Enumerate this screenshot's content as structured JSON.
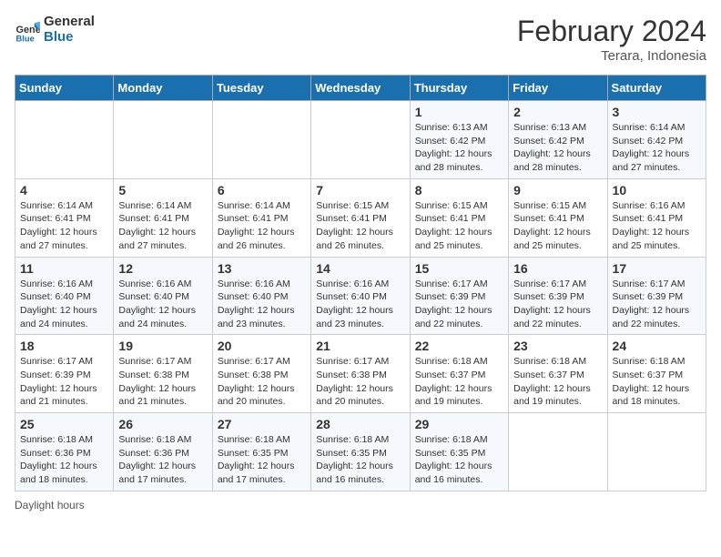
{
  "header": {
    "logo_line1": "General",
    "logo_line2": "Blue",
    "month_year": "February 2024",
    "location": "Terara, Indonesia"
  },
  "days_of_week": [
    "Sunday",
    "Monday",
    "Tuesday",
    "Wednesday",
    "Thursday",
    "Friday",
    "Saturday"
  ],
  "weeks": [
    [
      {
        "day": "",
        "info": ""
      },
      {
        "day": "",
        "info": ""
      },
      {
        "day": "",
        "info": ""
      },
      {
        "day": "",
        "info": ""
      },
      {
        "day": "1",
        "info": "Sunrise: 6:13 AM\nSunset: 6:42 PM\nDaylight: 12 hours and 28 minutes."
      },
      {
        "day": "2",
        "info": "Sunrise: 6:13 AM\nSunset: 6:42 PM\nDaylight: 12 hours and 28 minutes."
      },
      {
        "day": "3",
        "info": "Sunrise: 6:14 AM\nSunset: 6:42 PM\nDaylight: 12 hours and 27 minutes."
      }
    ],
    [
      {
        "day": "4",
        "info": "Sunrise: 6:14 AM\nSunset: 6:41 PM\nDaylight: 12 hours and 27 minutes."
      },
      {
        "day": "5",
        "info": "Sunrise: 6:14 AM\nSunset: 6:41 PM\nDaylight: 12 hours and 27 minutes."
      },
      {
        "day": "6",
        "info": "Sunrise: 6:14 AM\nSunset: 6:41 PM\nDaylight: 12 hours and 26 minutes."
      },
      {
        "day": "7",
        "info": "Sunrise: 6:15 AM\nSunset: 6:41 PM\nDaylight: 12 hours and 26 minutes."
      },
      {
        "day": "8",
        "info": "Sunrise: 6:15 AM\nSunset: 6:41 PM\nDaylight: 12 hours and 25 minutes."
      },
      {
        "day": "9",
        "info": "Sunrise: 6:15 AM\nSunset: 6:41 PM\nDaylight: 12 hours and 25 minutes."
      },
      {
        "day": "10",
        "info": "Sunrise: 6:16 AM\nSunset: 6:41 PM\nDaylight: 12 hours and 25 minutes."
      }
    ],
    [
      {
        "day": "11",
        "info": "Sunrise: 6:16 AM\nSunset: 6:40 PM\nDaylight: 12 hours and 24 minutes."
      },
      {
        "day": "12",
        "info": "Sunrise: 6:16 AM\nSunset: 6:40 PM\nDaylight: 12 hours and 24 minutes."
      },
      {
        "day": "13",
        "info": "Sunrise: 6:16 AM\nSunset: 6:40 PM\nDaylight: 12 hours and 23 minutes."
      },
      {
        "day": "14",
        "info": "Sunrise: 6:16 AM\nSunset: 6:40 PM\nDaylight: 12 hours and 23 minutes."
      },
      {
        "day": "15",
        "info": "Sunrise: 6:17 AM\nSunset: 6:39 PM\nDaylight: 12 hours and 22 minutes."
      },
      {
        "day": "16",
        "info": "Sunrise: 6:17 AM\nSunset: 6:39 PM\nDaylight: 12 hours and 22 minutes."
      },
      {
        "day": "17",
        "info": "Sunrise: 6:17 AM\nSunset: 6:39 PM\nDaylight: 12 hours and 22 minutes."
      }
    ],
    [
      {
        "day": "18",
        "info": "Sunrise: 6:17 AM\nSunset: 6:39 PM\nDaylight: 12 hours and 21 minutes."
      },
      {
        "day": "19",
        "info": "Sunrise: 6:17 AM\nSunset: 6:38 PM\nDaylight: 12 hours and 21 minutes."
      },
      {
        "day": "20",
        "info": "Sunrise: 6:17 AM\nSunset: 6:38 PM\nDaylight: 12 hours and 20 minutes."
      },
      {
        "day": "21",
        "info": "Sunrise: 6:17 AM\nSunset: 6:38 PM\nDaylight: 12 hours and 20 minutes."
      },
      {
        "day": "22",
        "info": "Sunrise: 6:18 AM\nSunset: 6:37 PM\nDaylight: 12 hours and 19 minutes."
      },
      {
        "day": "23",
        "info": "Sunrise: 6:18 AM\nSunset: 6:37 PM\nDaylight: 12 hours and 19 minutes."
      },
      {
        "day": "24",
        "info": "Sunrise: 6:18 AM\nSunset: 6:37 PM\nDaylight: 12 hours and 18 minutes."
      }
    ],
    [
      {
        "day": "25",
        "info": "Sunrise: 6:18 AM\nSunset: 6:36 PM\nDaylight: 12 hours and 18 minutes."
      },
      {
        "day": "26",
        "info": "Sunrise: 6:18 AM\nSunset: 6:36 PM\nDaylight: 12 hours and 17 minutes."
      },
      {
        "day": "27",
        "info": "Sunrise: 6:18 AM\nSunset: 6:35 PM\nDaylight: 12 hours and 17 minutes."
      },
      {
        "day": "28",
        "info": "Sunrise: 6:18 AM\nSunset: 6:35 PM\nDaylight: 12 hours and 16 minutes."
      },
      {
        "day": "29",
        "info": "Sunrise: 6:18 AM\nSunset: 6:35 PM\nDaylight: 12 hours and 16 minutes."
      },
      {
        "day": "",
        "info": ""
      },
      {
        "day": "",
        "info": ""
      }
    ]
  ],
  "footer": {
    "daylight_label": "Daylight hours"
  }
}
